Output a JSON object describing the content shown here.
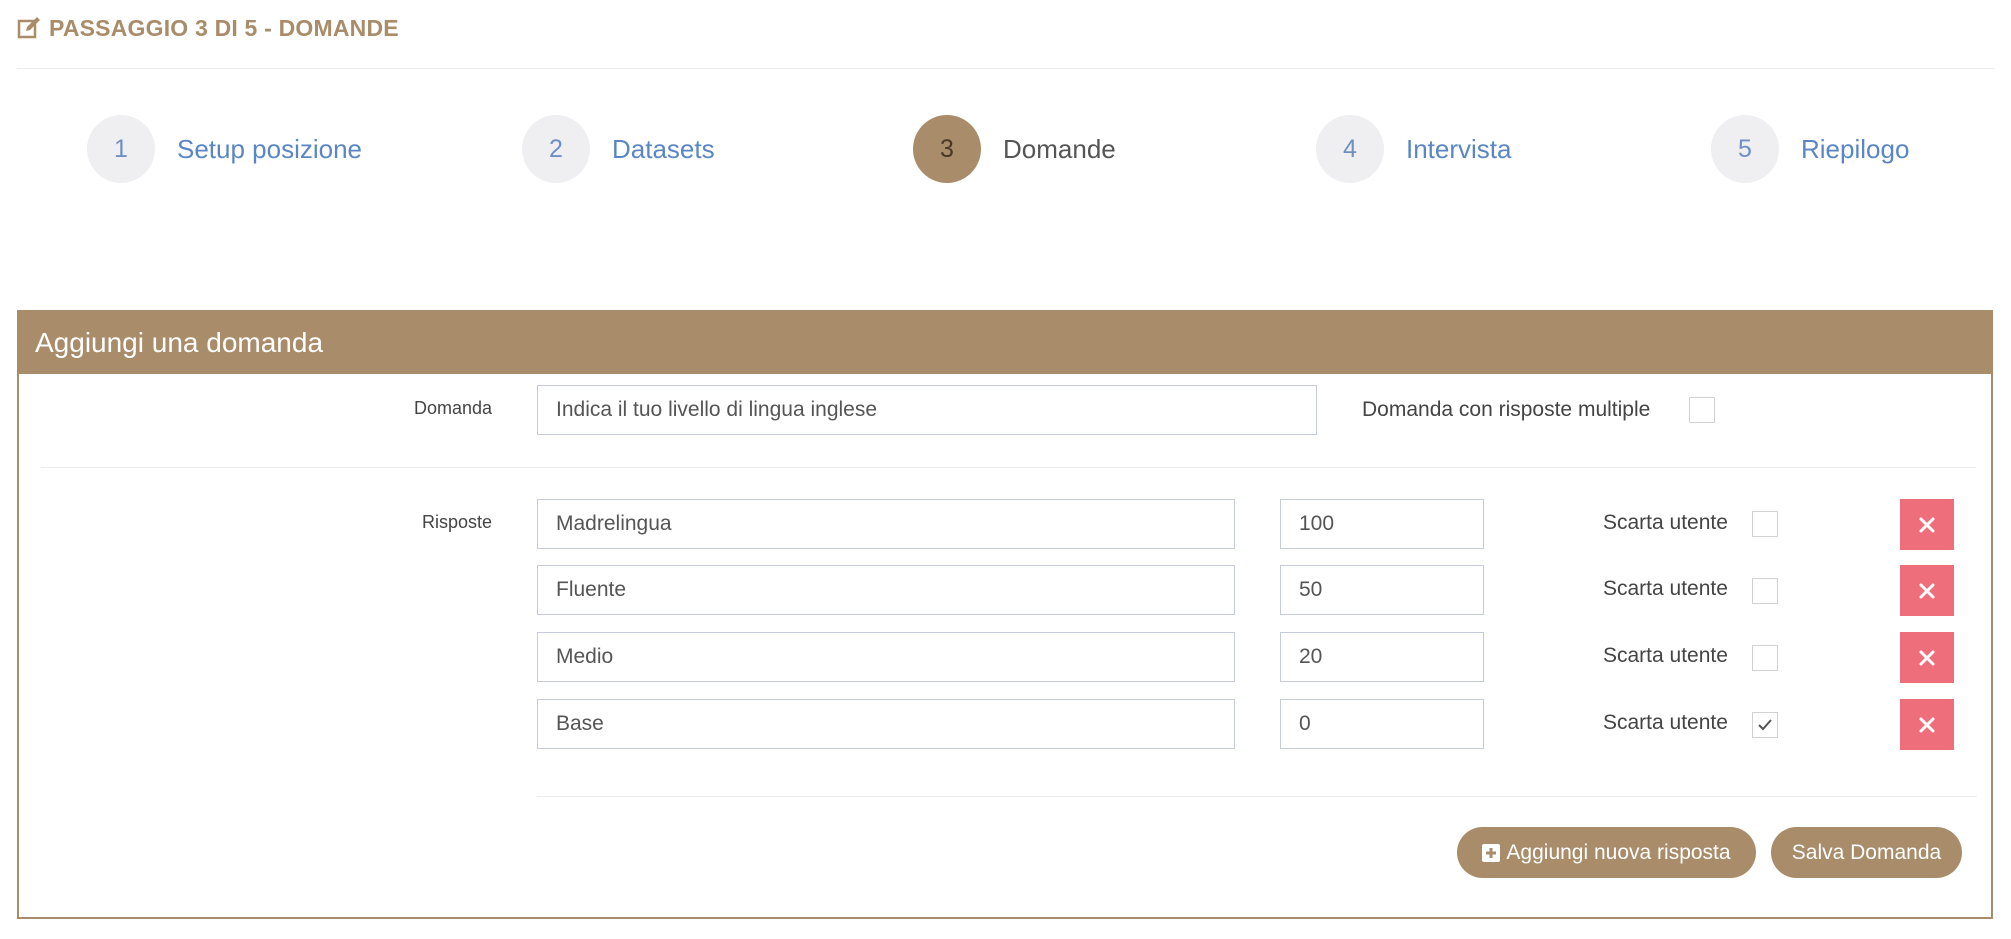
{
  "header": {
    "title": "PASSAGGIO 3 DI 5 - DOMANDE",
    "icon": "edit-icon",
    "color": "#a98c69"
  },
  "steps": [
    {
      "number": "1",
      "label": "Setup posizione",
      "active": false
    },
    {
      "number": "2",
      "label": "Datasets",
      "active": false
    },
    {
      "number": "3",
      "label": "Domande",
      "active": true
    },
    {
      "number": "4",
      "label": "Intervista",
      "active": false
    },
    {
      "number": "5",
      "label": "Riepilogo",
      "active": false
    }
  ],
  "panel": {
    "title": "Aggiungi una domanda",
    "question_label": "Domanda",
    "question_value": "Indica il tuo livello di lingua inglese",
    "multiple_label": "Domanda con risposte multiple",
    "multiple_checked": false,
    "answers_label": "Risposte",
    "answers": [
      {
        "text": "Madrelingua",
        "score": "100",
        "discard_label": "Scarta utente",
        "discard": false
      },
      {
        "text": "Fluente",
        "score": "50",
        "discard_label": "Scarta utente",
        "discard": false
      },
      {
        "text": "Medio",
        "score": "20",
        "discard_label": "Scarta utente",
        "discard": false
      },
      {
        "text": "Base",
        "score": "0",
        "discard_label": "Scarta utente",
        "discard": true
      }
    ],
    "add_answer_label": "Aggiungi nuova risposta",
    "save_label": "Salva Domanda"
  },
  "colors": {
    "accent": "#a98c69",
    "link": "#5b86c5",
    "danger": "#ef6e7c"
  }
}
